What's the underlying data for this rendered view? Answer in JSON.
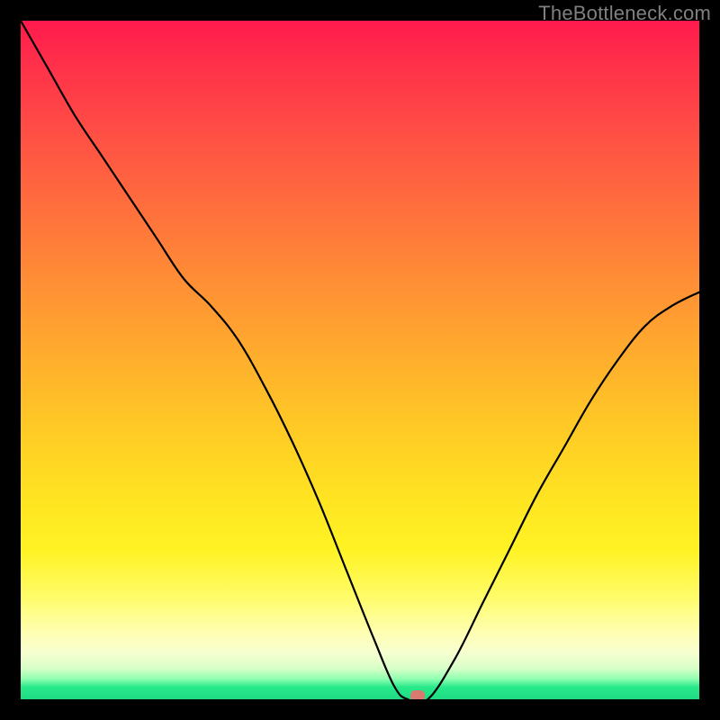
{
  "watermark": "TheBottleneck.com",
  "chart_data": {
    "type": "line",
    "title": "",
    "xlabel": "",
    "ylabel": "",
    "xlim": [
      0,
      100
    ],
    "ylim": [
      0,
      100
    ],
    "grid": false,
    "legend": false,
    "background": "red-yellow-green vertical gradient (bottleneck severity)",
    "series": [
      {
        "name": "bottleneck-curve",
        "x": [
          0,
          4,
          8,
          12,
          16,
          20,
          24,
          28,
          32,
          36,
          40,
          44,
          48,
          52,
          55,
          57,
          60,
          64,
          68,
          72,
          76,
          80,
          84,
          88,
          92,
          96,
          100
        ],
        "y": [
          100,
          93,
          86,
          80,
          74,
          68,
          62,
          58,
          53,
          46,
          38,
          29,
          19,
          9,
          2,
          0,
          0,
          6,
          14,
          22,
          30,
          37,
          44,
          50,
          55,
          58,
          60
        ]
      }
    ],
    "marker": {
      "x": 58.5,
      "y": 0,
      "color": "#d87a6f"
    }
  }
}
